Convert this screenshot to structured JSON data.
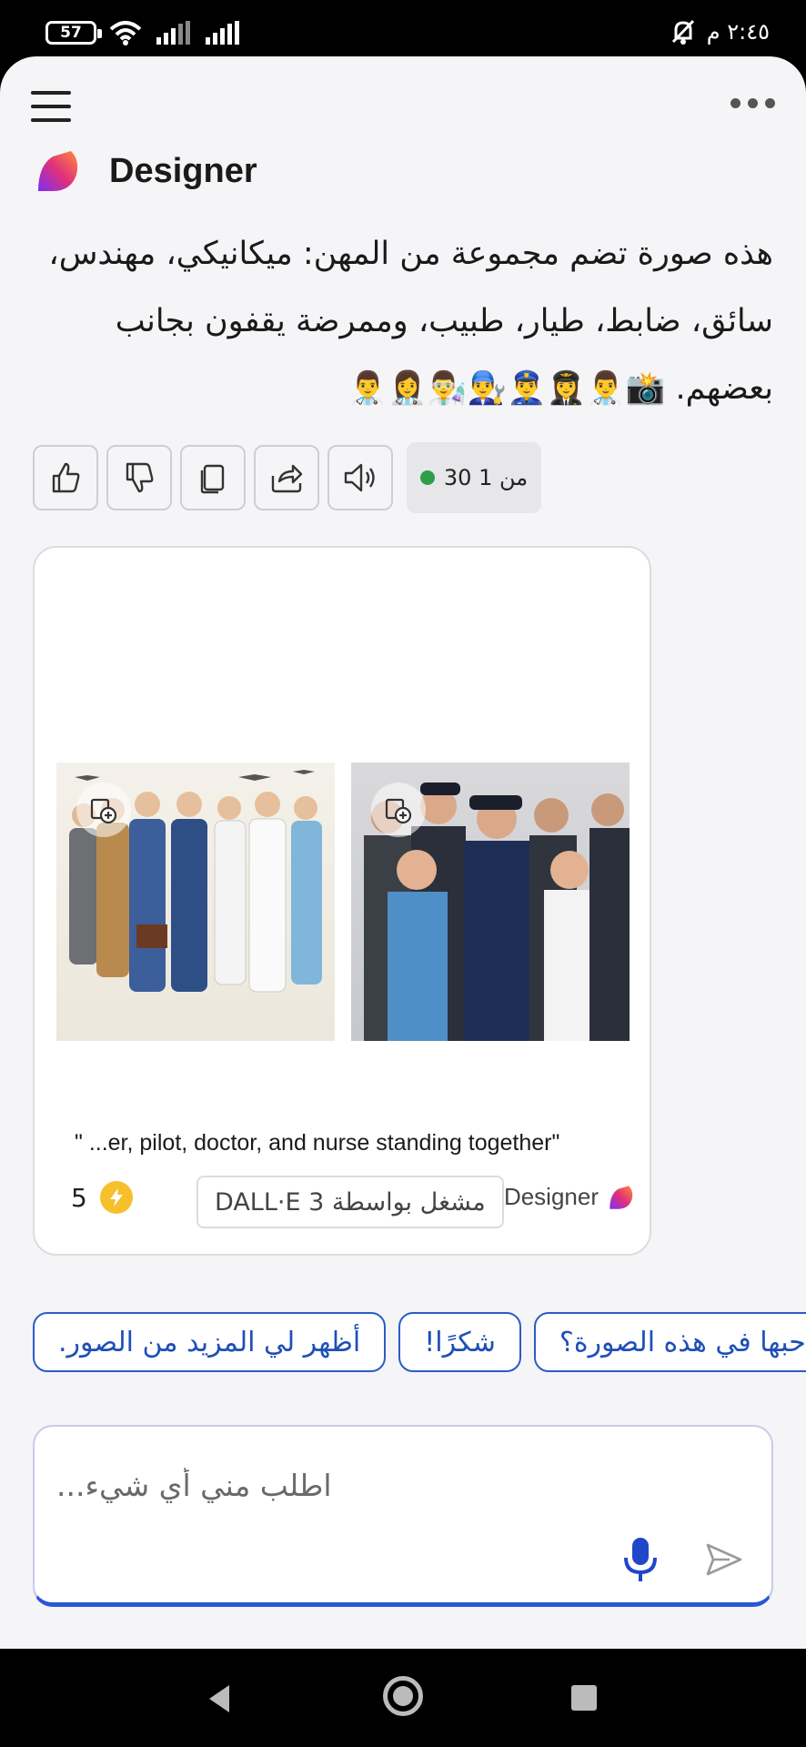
{
  "status_bar": {
    "battery": "57",
    "time": "٢:٤٥ م"
  },
  "header": {
    "designer_name": "Designer"
  },
  "message": {
    "text": "هذه صورة تضم مجموعة من المهن: ميكانيكي، مهندس، سائق، ضابط، طيار، طبيب، وممرضة يقفون بجانب بعضهم. 📸👨‍⚕️👩‍✈️👮‍♂️👨‍🔧👨‍🔬👩‍⚕️👨‍⚕️"
  },
  "actions": {
    "counter": "30 من 1",
    "icons": [
      "thumbs-up-icon",
      "thumbs-down-icon",
      "copy-icon",
      "share-icon",
      "speaker-icon"
    ]
  },
  "image_card": {
    "caption": "\" ...er, pilot, doctor, and nurse standing together\"",
    "credits": "5",
    "powered_by": "مشغل بواسطة DALL·E 3",
    "brand": "Designer"
  },
  "suggestions": [
    "أظهر لي المزيد من الصور.",
    "شكرًا!",
    "حبها في هذه الصورة؟"
  ],
  "input": {
    "placeholder": "اطلب مني أي شيء..."
  },
  "colors": {
    "accent": "#2b56d6",
    "chip_text": "#1e4fb8",
    "counter_dot": "#2e9e47"
  }
}
